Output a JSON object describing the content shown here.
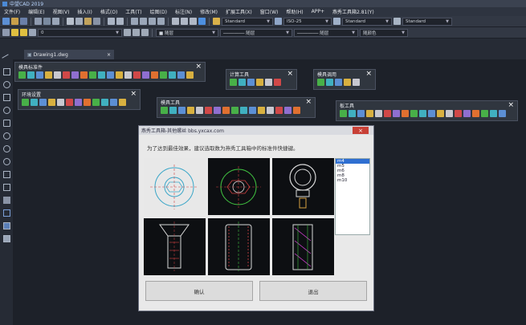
{
  "window": {
    "title": "中望CAD 2019"
  },
  "menu": [
    "文件(F)",
    "编辑(E)",
    "视图(V)",
    "插入(I)",
    "格式(O)",
    "工具(T)",
    "绘图(D)",
    "标注(N)",
    "修改(M)",
    "扩展工具(X)",
    "窗口(W)",
    "帮助(H)",
    "APP+",
    "燕秀工具箱2.81(Y)"
  ],
  "toolbar": {
    "text_style": "Standard",
    "dim_style": "ISO-25",
    "table_style": "Standard",
    "multileader_style": "Standard",
    "layer": "0",
    "color": "随层",
    "linetype": "随层",
    "lineweight": "随层",
    "plot_style": "随颜色"
  },
  "tab": {
    "label": "Drawing1.dwg",
    "close": "×"
  },
  "palettes": {
    "mold": {
      "title": "模具标准件"
    },
    "calc": {
      "title": "计算工具"
    },
    "template": {
      "title": "模具调用"
    },
    "env": {
      "title": "环境设置"
    },
    "mold_tools": {
      "title": "模具工具"
    },
    "pan": {
      "title": "板工具"
    }
  },
  "dialog": {
    "title": "燕秀工具箱-其他螺丝 bbs.yxcax.com",
    "message": "为了达到最佳效果，建议选取数为燕秀工具箱中的标准件快捷键。",
    "list_items": [
      "m4",
      "m5",
      "m6",
      "m8",
      "m10"
    ],
    "selected_index": 0,
    "ok_label": "确认",
    "cancel_label": "退出",
    "close": "×"
  },
  "colors": {
    "accent": "#2f6fd1",
    "close": "#c84036",
    "bg": "#262b35"
  }
}
